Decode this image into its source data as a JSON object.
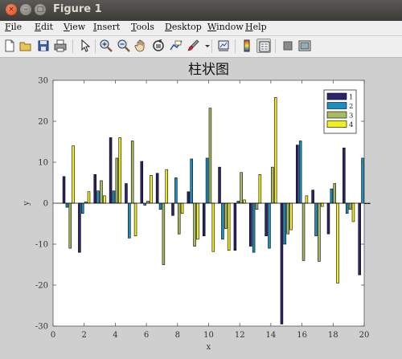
{
  "window": {
    "title": "Figure 1",
    "close_glyph": "×",
    "min_glyph": "–",
    "max_glyph": "□"
  },
  "menu": [
    "File",
    "Edit",
    "View",
    "Insert",
    "Tools",
    "Desktop",
    "Window",
    "Help"
  ],
  "toolbar": {
    "icons": [
      "new-figure-icon",
      "open-file-icon",
      "save-icon",
      "print-icon",
      "pointer-arrow-icon",
      "zoom-in-icon",
      "zoom-out-icon",
      "pan-hand-icon",
      "rotate-3d-icon",
      "data-cursor-icon",
      "brush-icon",
      "brush-dropdown-icon",
      "link-plot-icon",
      "colorbar-icon",
      "legend-icon",
      "hide-plot-tools-icon",
      "show-plot-tools-icon"
    ]
  },
  "chart_data": {
    "type": "bar",
    "title": "柱状图",
    "xlabel": "x",
    "ylabel": "y",
    "xlim": [
      0,
      20
    ],
    "ylim": [
      -30,
      30
    ],
    "xticks": [
      0,
      2,
      4,
      6,
      8,
      10,
      12,
      14,
      16,
      18,
      20
    ],
    "yticks": [
      -30,
      -20,
      -10,
      0,
      10,
      20,
      30
    ],
    "grid": false,
    "legend_position": "top-right",
    "x": [
      1,
      2,
      3,
      4,
      5,
      6,
      7,
      8,
      9,
      10,
      11,
      12,
      13,
      14,
      15,
      16,
      17,
      18,
      19,
      20
    ],
    "series": [
      {
        "name": "1",
        "color": "#2b2468",
        "values": [
          6.5,
          -12,
          7,
          16,
          4.8,
          10.2,
          7.3,
          -3,
          2.8,
          -8,
          8.8,
          -11.5,
          -10.5,
          -8,
          -29.5,
          14.2,
          3.2,
          -7.5,
          13.5,
          -17.5
        ]
      },
      {
        "name": "2",
        "color": "#1a8fbf",
        "values": [
          -1,
          -2.5,
          3,
          3,
          -8.5,
          -0.5,
          -1.5,
          6.2,
          10.8,
          11,
          -8.8,
          0.5,
          -12,
          -11,
          -10,
          15.2,
          -8,
          3.5,
          -2.5,
          11
        ]
      },
      {
        "name": "3",
        "color": "#a6bb62",
        "values": [
          -11,
          0.3,
          5.5,
          11,
          15.2,
          0.5,
          -15,
          -7.5,
          -10.5,
          23.2,
          -6.2,
          7.5,
          -1.5,
          8.8,
          -7.5,
          -14,
          -14.2,
          4.8,
          -1.5,
          0
        ]
      },
      {
        "name": "4",
        "color": "#f2ee1f",
        "values": [
          14,
          2.8,
          1.8,
          16,
          -8,
          6.8,
          8.2,
          -2.5,
          -8.8,
          -11.8,
          -11.5,
          0.8,
          7,
          25.8,
          -6.5,
          1.8,
          -0.8,
          -19.5,
          -4.5,
          0
        ]
      }
    ]
  }
}
